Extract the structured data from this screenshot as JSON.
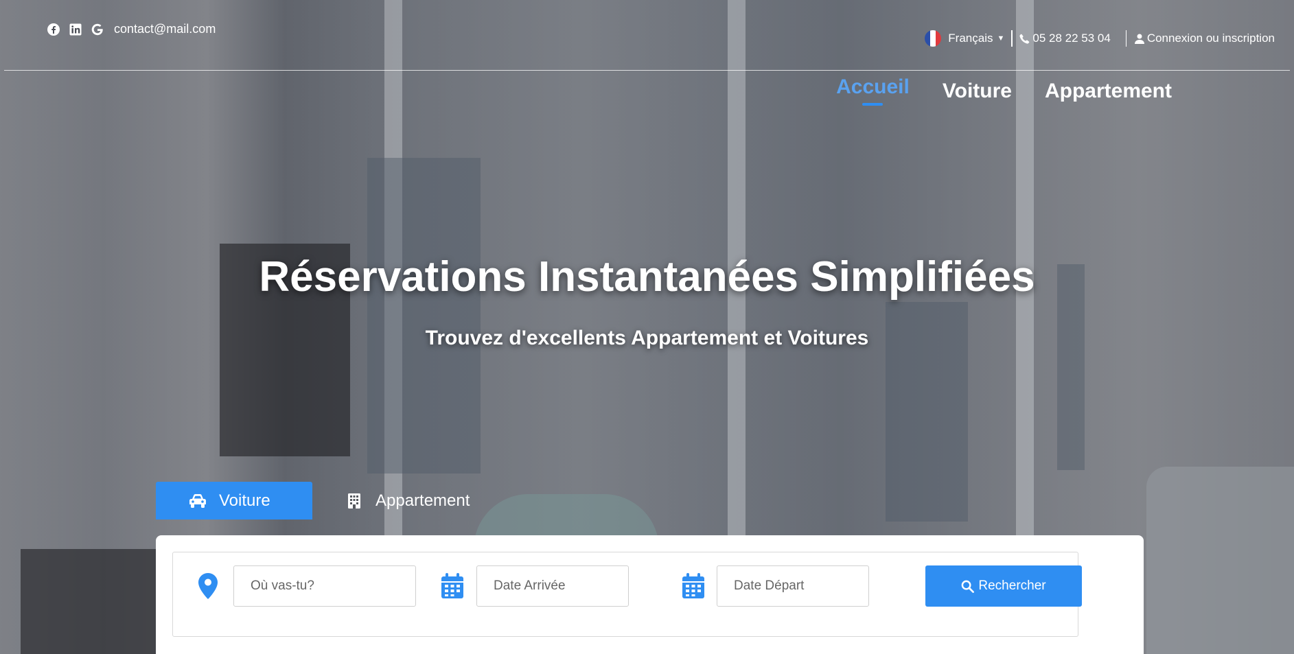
{
  "topbar": {
    "email": "contact@mail.com",
    "language": "Français",
    "phone": "05 28 22 53 04",
    "login": "Connexion ou inscription",
    "social_icons": [
      "facebook-icon",
      "linkedin-icon",
      "google-icon"
    ]
  },
  "nav": {
    "items": [
      {
        "label": "Accueil",
        "active": true
      },
      {
        "label": "Voiture",
        "active": false
      },
      {
        "label": "Appartement",
        "active": false
      }
    ]
  },
  "hero": {
    "title": "Réservations Instantanées Simplifiées",
    "subtitle": "Trouvez d'excellents Appartement et Voitures"
  },
  "tabs": [
    {
      "label": "Voiture",
      "icon": "car-icon",
      "active": true
    },
    {
      "label": "Appartement",
      "icon": "building-icon",
      "active": false
    }
  ],
  "search": {
    "destination_placeholder": "Où vas-tu?",
    "arrival_placeholder": "Date Arrivée",
    "departure_placeholder": "Date Départ",
    "button_label": "Rechercher"
  },
  "colors": {
    "accent": "#2f8ef2",
    "active_nav": "#5aa2f0"
  }
}
